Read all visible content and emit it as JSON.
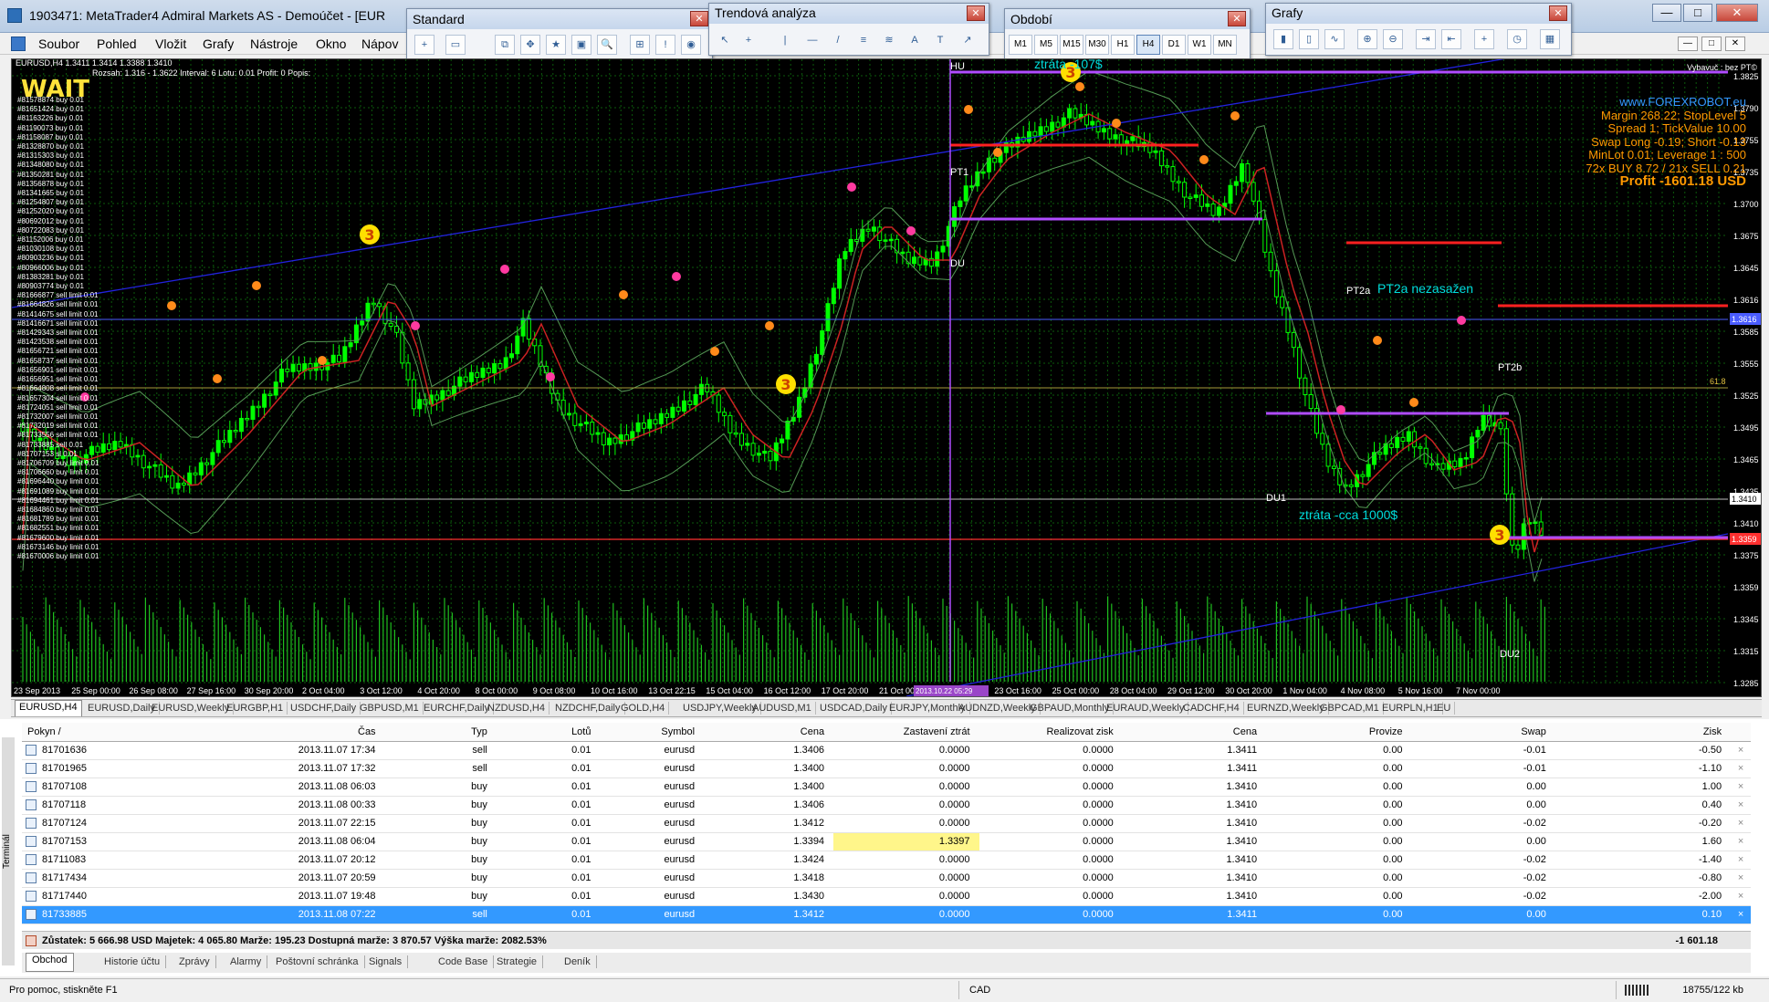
{
  "window": {
    "title": "1903471: MetaTrader4 Admiral Markets AS - Demoúčet - [EUR",
    "minimize": "—",
    "maximize": "□",
    "close": "✕"
  },
  "menu": {
    "items": [
      "Soubor",
      "Pohled",
      "Vložit",
      "Grafy",
      "Nástroje",
      "Okno",
      "Nápov"
    ],
    "mdi_buttons": [
      "—",
      "□",
      "✕"
    ]
  },
  "toolbars": {
    "standard": {
      "title": "Standard",
      "close": "✕",
      "buttons": [
        "+",
        "▭",
        "⧉",
        "✥",
        "★",
        "▣",
        "🔍",
        "⊞",
        "!",
        "◉"
      ]
    },
    "trend": {
      "title": "Trendová analýza",
      "close": "✕",
      "buttons": [
        "↖",
        "+",
        "|",
        "—",
        "/",
        "≡",
        "≋",
        "A",
        "T",
        "↗"
      ]
    },
    "period": {
      "title": "Období",
      "close": "✕",
      "buttons": [
        "M1",
        "M5",
        "M15",
        "M30",
        "H1",
        "H4",
        "D1",
        "W1",
        "MN"
      ],
      "active": "H4"
    },
    "charts": {
      "title": "Grafy",
      "close": "✕",
      "buttons": [
        "▮",
        "▯",
        "∿",
        "⊕",
        "⊖",
        "⇥",
        "⇤",
        "+",
        "◷",
        "▦"
      ]
    }
  },
  "chart": {
    "header": "EURUSD,H4  1.3411 1.3414 1.3388 1.3410",
    "info": "Rozsah: 1.316 - 1.3622  Interval: 6  Lotu: 0.01  Profit: 0  Popis:",
    "wait_label": "WAIT",
    "expert_label": "Vybavuč : bez PT©",
    "colors": {
      "background": "#000000",
      "grid": "#0b5a0b",
      "candles": "#00ff00",
      "price_line": "#c0c0c0",
      "ask_line": "#ff3030",
      "bb_band": "#559955",
      "ma_line": "#cc2222",
      "channel_line": "#2222dd",
      "magenta_line": "#b04cff",
      "red_level": "#ff2020",
      "info_orange": "#ff9900",
      "info_blue": "#3399ff",
      "cyan_text": "#00dddd"
    },
    "info_panel": {
      "site": "www.FOREXROBOT.eu",
      "margin": "Margin 268.22; StopLevel 5",
      "spread": "Spread 1; TickValue 10.00",
      "swap": "Swap Long -0.19; Short -0.13",
      "minlot": "MinLot 0.01; Leverage 1 : 500",
      "positions": "72x BUY 8.72 / 21x SELL 0.21",
      "profit": "Profit -1601.18 USD"
    },
    "annotations": {
      "hu": "HU",
      "ztrata_top": "ztráta -107$",
      "pt1": "PT1",
      "du": "DU",
      "pt2a": "PT2a",
      "pt2a_text": "PT2a nezasažen",
      "pt2b": "PT2b",
      "du1": "DU1",
      "ztrata_du1": "ztráta -cca 1000$",
      "du2": "DU2",
      "num3": "3",
      "vertical_date": "2013.10.22 05:29"
    },
    "left_orders": [
      "#81578874 buy 0.01",
      "#81651424 buy 0.01",
      "#81163226 buy 0.01",
      "#81190073 buy 0.01",
      "#81158087 buy 0.01",
      "#81328870 buy 0.01",
      "#81315303 buy 0.01",
      "#81348080 buy 0.01",
      "#81350281 buy 0.01",
      "#81356878 buy 0.01",
      "#81341665 buy 0.01",
      "#81254807 buy 0.01",
      "#81252020 buy 0.01",
      "#80692012 buy 0.01",
      "#80722083 buy 0.01",
      "#81152006 buy 0.01",
      "#81030108 buy 0.01",
      "#80903236 buy 0.01",
      "#80966006 buy 0.01",
      "#81383281 buy 0.01",
      "#80903774 buy 0.01",
      "#81666877 sell limit 0.01",
      "#81664826 sell limit 0.01",
      "#81414675 sell limit 0.01",
      "#81416671 sell limit 0.01",
      "#81429343 sell limit 0.01",
      "#81423538 sell limit 0.01",
      "#81656721 sell limit 0.01",
      "#81658737 sell limit 0.01",
      "#81656901 sell limit 0.01",
      "#81656951 sell limit 0.01",
      "#81664808 sell limit 0.01",
      "#81657304 sell limit 0.01",
      "#81724051 sell limit 0.01",
      "#81732007 sell limit 0.01",
      "#81732019 sell limit 0.01",
      "#81733556 sell limit 0.01",
      "#81733885 sell 0.01",
      "#81707153 sl 0.01",
      "#81706709 buy limit 0.01",
      "#81706660 buy limit 0.01",
      "#81696440 buy limit 0.01",
      "#81691089 buy limit 0.01",
      "#81694461 buy limit 0.01",
      "#81684860 buy limit 0.01",
      "#81681789 buy limit 0.01",
      "#81682551 buy limit 0.01",
      "#81679600 buy limit 0.01",
      "#81673146 buy limit 0.01",
      "#81670006 buy limit 0.01"
    ],
    "y_ticks": [
      "1.3825",
      "1.3790",
      "1.3755",
      "1.3735",
      "1.3700",
      "1.3675",
      "1.3645",
      "1.3616",
      "1.3585",
      "1.3555",
      "1.3525",
      "1.3495",
      "1.3465",
      "1.3435",
      "1.3410",
      "1.3375",
      "1.3359",
      "1.3345",
      "1.3315",
      "1.3285"
    ],
    "price_badges": {
      "current": "1.3410",
      "ask_level": "1.3359",
      "blue_level": "1.3616",
      "fib": "61.8"
    },
    "x_ticks": [
      "23 Sep 2013",
      "25 Sep 00:00",
      "26 Sep 08:00",
      "27 Sep 16:00",
      "30 Sep 20:00",
      "2 Oct 04:00",
      "3 Oct 12:00",
      "4 Oct 20:00",
      "8 Oct 00:00",
      "9 Oct 08:00",
      "10 Oct 16:00",
      "13 Oct 22:15",
      "15 Oct 04:00",
      "16 Oct 12:00",
      "17 Oct 20:00",
      "21 Oct 00:00",
      "22 Oct 08:00",
      "23 Oct 16:00",
      "25 Oct 00:00",
      "28 Oct 04:00",
      "29 Oct 12:00",
      "30 Oct 20:00",
      "1 Nov 04:00",
      "4 Nov 08:00",
      "5 Nov 16:00",
      "7 Nov 00:00"
    ]
  },
  "chart_tabs": {
    "items": [
      "EURUSD,H4",
      "EURUSD,Daily",
      "EURUSD,Weekly",
      "EURGBP,H1",
      "USDCHF,Daily",
      "GBPUSD,M1",
      "EURCHF,Daily",
      "NZDUSD,H4",
      "NZDCHF,Daily",
      "GOLD,H4",
      "USDJPY,Weekly",
      "AUDUSD,M1",
      "USDCAD,Daily",
      "EURJPY,Monthly",
      "AUDNZD,Weekly",
      "GBPAUD,Monthly",
      "EURAUD,Weekly",
      "CADCHF,H4",
      "EURNZD,Weekly",
      "GBPCAD,M1",
      "EURPLN,H1",
      "EU"
    ],
    "active": 0
  },
  "terminal": {
    "side_title": "Terminál",
    "columns": [
      "Pokyn /",
      "Čas",
      "Typ",
      "Lotů",
      "Symbol",
      "Cena",
      "Zastavení ztrát",
      "Realizovat zisk",
      "Cena",
      "Provize",
      "Swap",
      "Zisk"
    ],
    "rows": [
      {
        "order": "81701636",
        "time": "2013.11.07 17:34",
        "type": "sell",
        "lots": "0.01",
        "symbol": "eurusd",
        "price": "1.3406",
        "sl": "0.0000",
        "tp": "0.0000",
        "cur": "1.3411",
        "comm": "0.00",
        "swap": "-0.01",
        "profit": "-0.50"
      },
      {
        "order": "81701965",
        "time": "2013.11.07 17:32",
        "type": "sell",
        "lots": "0.01",
        "symbol": "eurusd",
        "price": "1.3400",
        "sl": "0.0000",
        "tp": "0.0000",
        "cur": "1.3411",
        "comm": "0.00",
        "swap": "-0.01",
        "profit": "-1.10"
      },
      {
        "order": "81707108",
        "time": "2013.11.08 06:03",
        "type": "buy",
        "lots": "0.01",
        "symbol": "eurusd",
        "price": "1.3400",
        "sl": "0.0000",
        "tp": "0.0000",
        "cur": "1.3410",
        "comm": "0.00",
        "swap": "0.00",
        "profit": "1.00"
      },
      {
        "order": "81707118",
        "time": "2013.11.08 00:33",
        "type": "buy",
        "lots": "0.01",
        "symbol": "eurusd",
        "price": "1.3406",
        "sl": "0.0000",
        "tp": "0.0000",
        "cur": "1.3410",
        "comm": "0.00",
        "swap": "0.00",
        "profit": "0.40"
      },
      {
        "order": "81707124",
        "time": "2013.11.07 22:15",
        "type": "buy",
        "lots": "0.01",
        "symbol": "eurusd",
        "price": "1.3412",
        "sl": "0.0000",
        "tp": "0.0000",
        "cur": "1.3410",
        "comm": "0.00",
        "swap": "-0.02",
        "profit": "-0.20"
      },
      {
        "order": "81707153",
        "time": "2013.11.08 06:04",
        "type": "buy",
        "lots": "0.01",
        "symbol": "eurusd",
        "price": "1.3394",
        "sl": "1.3397",
        "tp": "0.0000",
        "cur": "1.3410",
        "comm": "0.00",
        "swap": "0.00",
        "profit": "1.60",
        "sl_highlight": true
      },
      {
        "order": "81711083",
        "time": "2013.11.07 20:12",
        "type": "buy",
        "lots": "0.01",
        "symbol": "eurusd",
        "price": "1.3424",
        "sl": "0.0000",
        "tp": "0.0000",
        "cur": "1.3410",
        "comm": "0.00",
        "swap": "-0.02",
        "profit": "-1.40"
      },
      {
        "order": "81717434",
        "time": "2013.11.07 20:59",
        "type": "buy",
        "lots": "0.01",
        "symbol": "eurusd",
        "price": "1.3418",
        "sl": "0.0000",
        "tp": "0.0000",
        "cur": "1.3410",
        "comm": "0.00",
        "swap": "-0.02",
        "profit": "-0.80"
      },
      {
        "order": "81717440",
        "time": "2013.11.07 19:48",
        "type": "buy",
        "lots": "0.01",
        "symbol": "eurusd",
        "price": "1.3430",
        "sl": "0.0000",
        "tp": "0.0000",
        "cur": "1.3410",
        "comm": "0.00",
        "swap": "-0.02",
        "profit": "-2.00"
      },
      {
        "order": "81733885",
        "time": "2013.11.08 07:22",
        "type": "sell",
        "lots": "0.01",
        "symbol": "eurusd",
        "price": "1.3412",
        "sl": "0.0000",
        "tp": "0.0000",
        "cur": "1.3411",
        "comm": "0.00",
        "swap": "0.00",
        "profit": "0.10",
        "selected": true
      }
    ],
    "row_close": "×",
    "balance": "Zůstatek: 5 666.98 USD  Majetek: 4 065.80  Marže: 195.23  Dostupná marže: 3 870.57  Výška marže: 2082.53%",
    "total_profit": "-1 601.18",
    "tabs": [
      "Obchod",
      "Historie účtu",
      "Zprávy",
      "Alarmy",
      "Poštovní schránka",
      "Signals",
      "Code Base",
      "Strategie",
      "Deník"
    ],
    "active_tab": 0
  },
  "statusbar": {
    "help": "Pro pomoc, stiskněte F1",
    "currency": "CAD",
    "size": "18755/122 kb"
  }
}
